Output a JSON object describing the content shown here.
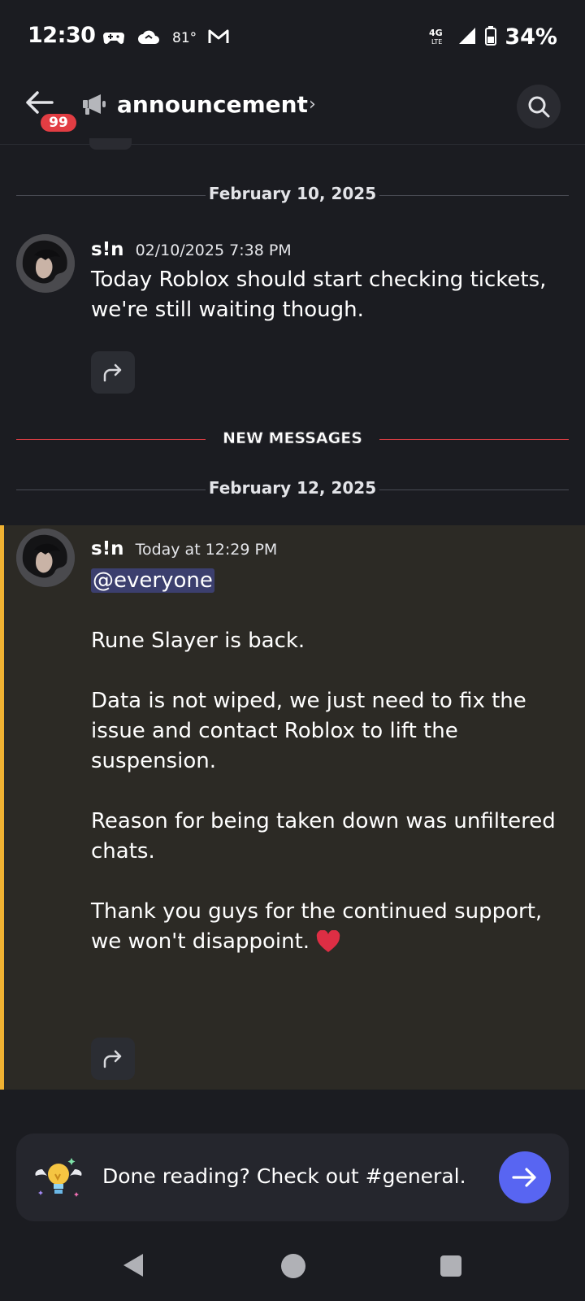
{
  "status_bar": {
    "time": "12:30",
    "temperature": "81°",
    "network": "4G LTE",
    "battery": "34%",
    "icons": [
      "game-controller-icon",
      "cloud-icon",
      "gmail-icon",
      "signal-icon",
      "battery-icon"
    ]
  },
  "header": {
    "unread_badge": "99",
    "channel_name": "announcement",
    "chevron": "›",
    "icons": [
      "back-arrow-icon",
      "megaphone-icon",
      "search-icon"
    ]
  },
  "dividers": {
    "date_1": "February 10, 2025",
    "new_messages": "NEW MESSAGES",
    "date_2": "February 12, 2025"
  },
  "messages": [
    {
      "username": "s!n",
      "timestamp": "02/10/2025 7:38 PM",
      "lines": [
        "Today Roblox should start checking tickets,",
        "we're still waiting though."
      ]
    },
    {
      "username": "s!n",
      "timestamp": "Today at 12:29 PM",
      "mention": "@everyone",
      "paragraphs": [
        "Rune Slayer is back.",
        "Data is not wiped, we just need to fix the issue and contact Roblox to lift the suspension.",
        "Reason for being taken down was unfiltered chats.",
        "Thank you guys for the continued support, we won't disappoint."
      ],
      "emoji": "heart-icon"
    }
  ],
  "prompt": {
    "text": "Done reading? Check out #general."
  },
  "colors": {
    "accent": "#5865f2",
    "highlight_bar": "#f0b232",
    "new_line": "#d23c42",
    "badge": "#e23d43"
  }
}
